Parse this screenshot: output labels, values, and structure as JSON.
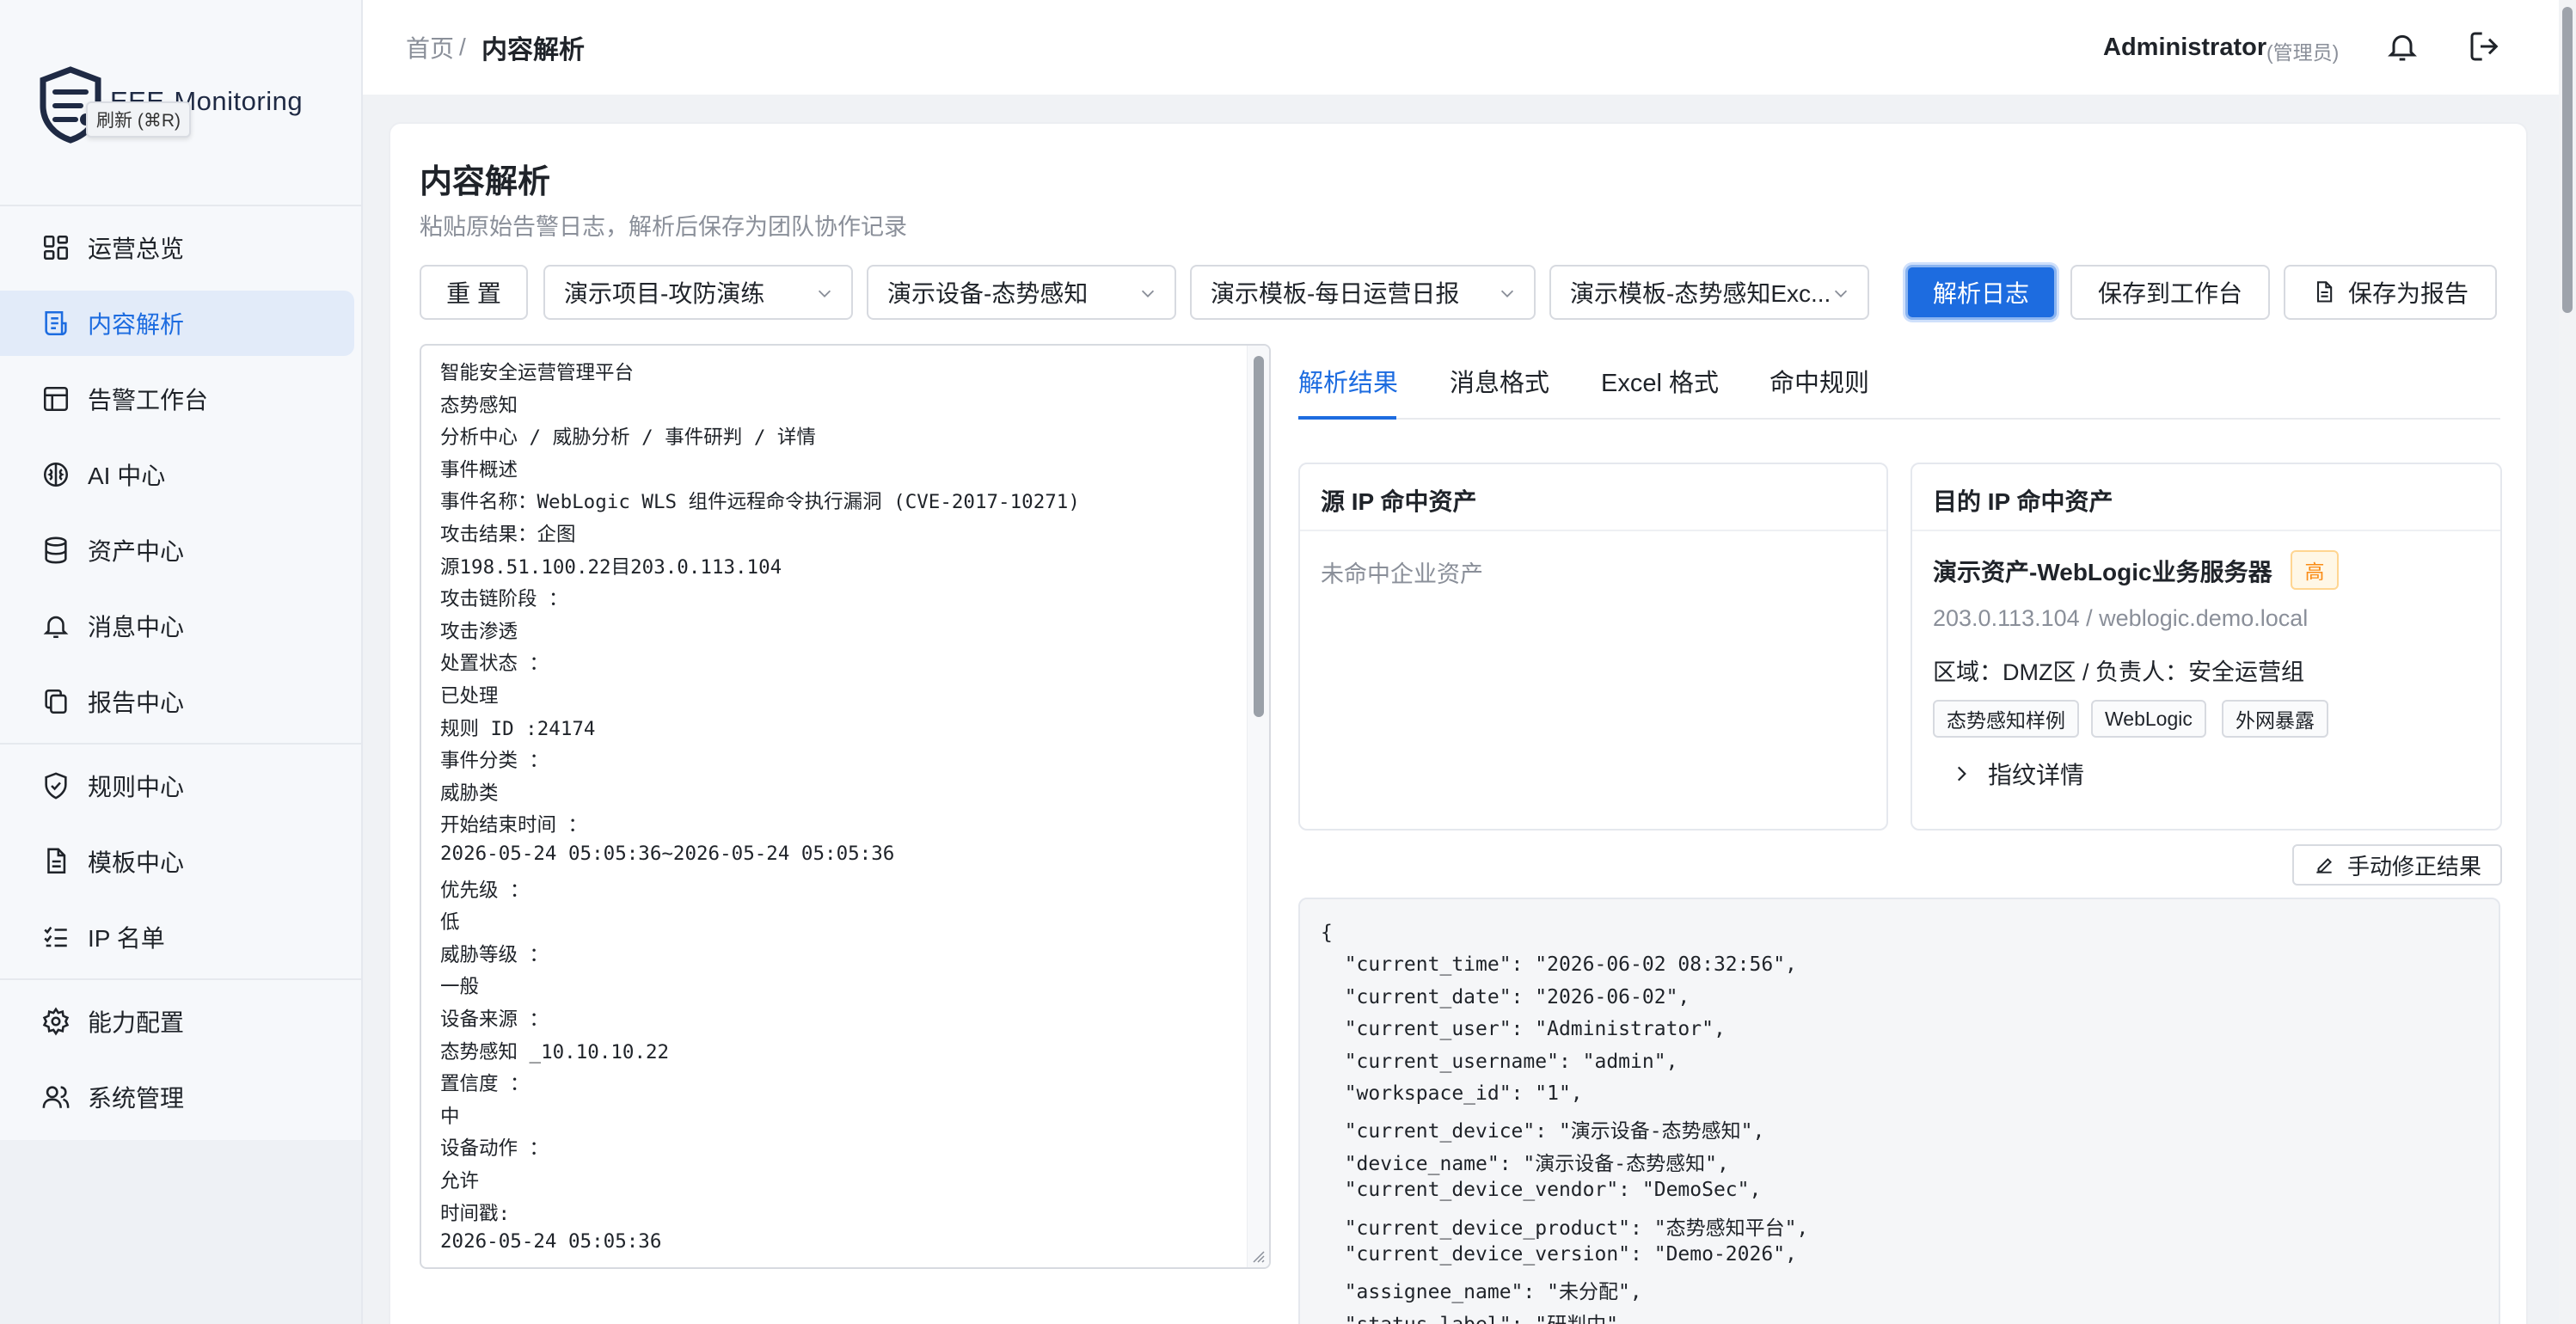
{
  "brand": {
    "name": "EEE-Monitoring",
    "tooltip": "刷新 (⌘R)"
  },
  "sidebar": {
    "items": [
      {
        "label": "运营总览",
        "icon": "dashboard-icon"
      },
      {
        "label": "内容解析",
        "icon": "parse-icon",
        "active": true
      },
      {
        "label": "告警工作台",
        "icon": "table-icon"
      },
      {
        "label": "AI 中心",
        "icon": "brain-icon"
      },
      {
        "label": "资产中心",
        "icon": "database-icon"
      },
      {
        "label": "消息中心",
        "icon": "bell-icon"
      },
      {
        "label": "报告中心",
        "icon": "copy-icon"
      },
      {
        "label": "规则中心",
        "icon": "shield-icon"
      },
      {
        "label": "模板中心",
        "icon": "file-icon"
      },
      {
        "label": "IP 名单",
        "icon": "list-check-icon"
      },
      {
        "label": "能力配置",
        "icon": "gear-icon"
      },
      {
        "label": "系统管理",
        "icon": "users-icon"
      }
    ]
  },
  "header": {
    "breadcrumb_home": "首页",
    "breadcrumb_sep": "/",
    "breadcrumb_current": "内容解析",
    "user_name": "Administrator",
    "user_role": "(管理员)"
  },
  "page": {
    "title": "内容解析",
    "subtitle": "粘贴原始告警日志，解析后保存为团队协作记录"
  },
  "toolbar": {
    "reset": "重 置",
    "project_select": "演示项目-攻防演练",
    "device_select": "演示设备-态势感知",
    "template_select": "演示模板-每日运营日报",
    "excel_template_select": "演示模板-态势感知Exc...",
    "parse": "解析日志",
    "save_workspace": "保存到工作台",
    "save_report": "保存为报告"
  },
  "log_lines": [
    "智能安全运营管理平台",
    "态势感知",
    "分析中心 / 威胁分析 / 事件研判 / 详情",
    "事件概述",
    "事件名称：WebLogic WLS 组件远程命令执行漏洞 (CVE-2017-10271)",
    "攻击结果：企图",
    "源198.51.100.22目203.0.113.104",
    "攻击链阶段 ：",
    "攻击渗透",
    "处置状态 ：",
    "已处理",
    "规则 ID :24174",
    "事件分类 ：",
    "威胁类",
    "开始结束时间 ：",
    "2026-05-24 05:05:36~2026-05-24 05:05:36",
    "优先级 ：",
    "低",
    "威胁等级 ：",
    "一般",
    "设备来源 ：",
    "态势感知 _10.10.10.22",
    "置信度 ：",
    "中",
    "设备动作 ：",
    "允许",
    "时间戳:",
    "2026-05-24 05:05:36"
  ],
  "tabs": [
    "解析结果",
    "消息格式",
    "Excel 格式",
    "命中规则"
  ],
  "src_panel": {
    "title": "源 IP 命中资产",
    "empty": "未命中企业资产"
  },
  "dst_panel": {
    "title": "目的 IP 命中资产",
    "asset_name": "演示资产-WebLogic业务服务器",
    "level": "高",
    "address": "203.0.113.104 / weblogic.demo.local",
    "owner": "区域：DMZ区 / 负责人：安全运营组",
    "tags": [
      "态势感知样例",
      "WebLogic",
      "外网暴露"
    ],
    "fingerprint": "指纹详情"
  },
  "manual_fix": "手动修正结果",
  "json_lines": [
    "{",
    "  \"current_time\": \"2026-06-02 08:32:56\",",
    "  \"current_date\": \"2026-06-02\",",
    "  \"current_user\": \"Administrator\",",
    "  \"current_username\": \"admin\",",
    "  \"workspace_id\": \"1\",",
    "  \"current_device\": \"演示设备-态势感知\",",
    "  \"device_name\": \"演示设备-态势感知\",",
    "  \"current_device_vendor\": \"DemoSec\",",
    "  \"current_device_product\": \"态势感知平台\",",
    "  \"current_device_version\": \"Demo-2026\",",
    "  \"assignee_name\": \"未分配\",",
    "  \"status_label\": \"研判中\""
  ],
  "colors": {
    "accent": "#1d6ce0",
    "sidebar_bg": "#f6f8fb",
    "high_badge": "#fa8c16"
  }
}
